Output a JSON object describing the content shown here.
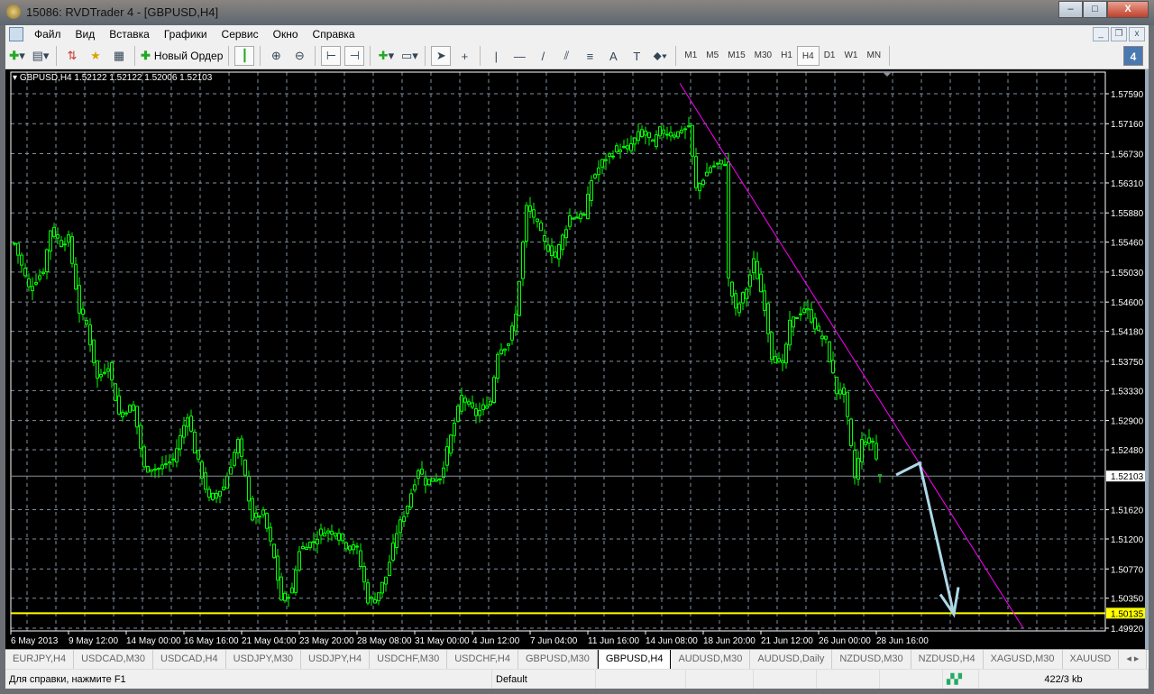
{
  "window": {
    "title": "15086: RVDTrader 4 - [GBPUSD,H4]",
    "min": "‒",
    "max": "□",
    "close": "X"
  },
  "menu": [
    "Файл",
    "Вид",
    "Вставка",
    "Графики",
    "Сервис",
    "Окно",
    "Справка"
  ],
  "toolbar": {
    "new_order": "Новый Ордер",
    "tools": [
      "A",
      "T"
    ],
    "timeframes": [
      "M1",
      "M5",
      "M15",
      "M30",
      "H1",
      "H4",
      "D1",
      "W1",
      "MN"
    ],
    "active_timeframe": "H4",
    "notification_count": "4"
  },
  "chart_header": "GBPUSD,H4  1.52122 1.52122 1.52006 1.52103",
  "chart_data": {
    "type": "candlestick",
    "symbol": "GBPUSD",
    "timeframe": "H4",
    "ohlc_last": {
      "open": 1.52122,
      "high": 1.52122,
      "low": 1.52006,
      "close": 1.52103
    },
    "bars": 241,
    "close_path": [
      [
        0,
        1.5544
      ],
      [
        4,
        1.548
      ],
      [
        8,
        1.5505
      ],
      [
        10,
        1.5564
      ],
      [
        13,
        1.5544
      ],
      [
        15,
        1.5551
      ],
      [
        18,
        1.5447
      ],
      [
        20,
        1.5428
      ],
      [
        23,
        1.535
      ],
      [
        26,
        1.537
      ],
      [
        29,
        1.5299
      ],
      [
        33,
        1.5311
      ],
      [
        36,
        1.5221
      ],
      [
        40,
        1.5221
      ],
      [
        44,
        1.5234
      ],
      [
        48,
        1.5299
      ],
      [
        50,
        1.5247
      ],
      [
        54,
        1.5176
      ],
      [
        58,
        1.5195
      ],
      [
        62,
        1.526
      ],
      [
        64,
        1.5208
      ],
      [
        66,
        1.515
      ],
      [
        69,
        1.5156
      ],
      [
        72,
        1.5092
      ],
      [
        74,
        1.5033
      ],
      [
        77,
        1.5046
      ],
      [
        79,
        1.5105
      ],
      [
        83,
        1.5117
      ],
      [
        85,
        1.513
      ],
      [
        89,
        1.513
      ],
      [
        92,
        1.5111
      ],
      [
        95,
        1.5105
      ],
      [
        98,
        1.5033
      ],
      [
        100,
        1.5033
      ],
      [
        103,
        1.5066
      ],
      [
        106,
        1.513
      ],
      [
        109,
        1.5169
      ],
      [
        112,
        1.5221
      ],
      [
        114,
        1.5202
      ],
      [
        118,
        1.5208
      ],
      [
        122,
        1.5286
      ],
      [
        124,
        1.5324
      ],
      [
        128,
        1.5299
      ],
      [
        132,
        1.5318
      ],
      [
        134,
        1.5389
      ],
      [
        137,
        1.5402
      ],
      [
        139,
        1.5441
      ],
      [
        142,
        1.5596
      ],
      [
        144,
        1.5583
      ],
      [
        147,
        1.5544
      ],
      [
        150,
        1.5525
      ],
      [
        154,
        1.5583
      ],
      [
        158,
        1.5583
      ],
      [
        160,
        1.5635
      ],
      [
        163,
        1.5661
      ],
      [
        167,
        1.568
      ],
      [
        170,
        1.568
      ],
      [
        174,
        1.5706
      ],
      [
        177,
        1.5687
      ],
      [
        179,
        1.5706
      ],
      [
        183,
        1.57
      ],
      [
        187,
        1.5712
      ],
      [
        189,
        1.5622
      ],
      [
        193,
        1.5654
      ],
      [
        197,
        1.5661
      ],
      [
        198,
        1.5492
      ],
      [
        200,
        1.5447
      ],
      [
        203,
        1.548
      ],
      [
        205,
        1.5518
      ],
      [
        208,
        1.5454
      ],
      [
        210,
        1.5383
      ],
      [
        213,
        1.537
      ],
      [
        215,
        1.5428
      ],
      [
        218,
        1.5447
      ],
      [
        220,
        1.5447
      ],
      [
        223,
        1.5415
      ],
      [
        225,
        1.5402
      ],
      [
        228,
        1.5331
      ],
      [
        230,
        1.5331
      ],
      [
        233,
        1.5208
      ],
      [
        235,
        1.526
      ],
      [
        238,
        1.526
      ],
      [
        240,
        1.521
      ]
    ],
    "y_ticks": [
      "1.57590",
      "1.57160",
      "1.56730",
      "1.56310",
      "1.55880",
      "1.55460",
      "1.55030",
      "1.54600",
      "1.54180",
      "1.53750",
      "1.53330",
      "1.52900",
      "1.52480",
      "1.51620",
      "1.51200",
      "1.50770",
      "1.50350",
      "1.49920"
    ],
    "y_tick_values": [
      1.5759,
      1.5716,
      1.5673,
      1.5631,
      1.5588,
      1.5546,
      1.5503,
      1.546,
      1.5418,
      1.5375,
      1.5333,
      1.529,
      1.5248,
      1.5162,
      1.512,
      1.5077,
      1.5035,
      1.4992
    ],
    "x_ticks": [
      "6 May 2013",
      "9 May 12:00",
      "14 May 00:00",
      "16 May 16:00",
      "21 May 04:00",
      "23 May 20:00",
      "28 May 08:00",
      "31 May 00:00",
      "4 Jun 12:00",
      "7 Jun 04:00",
      "11 Jun 16:00",
      "14 Jun 08:00",
      "18 Jun 20:00",
      "21 Jun 12:00",
      "26 Jun 00:00",
      "28 Jun 16:00"
    ],
    "x_tick_bars_step": 16,
    "bid_price": "1.52103",
    "bid_value": 1.52103,
    "support_line": "1.50135",
    "support_value": 1.50135,
    "trendline": [
      [
        184.5,
        1.5774
      ],
      [
        279.75,
        1.4992
      ]
    ],
    "forecast_arrow": [
      [
        244.5,
        1.5212
      ],
      [
        251,
        1.5229
      ],
      [
        260.5,
        1.5012
      ]
    ],
    "colors": {
      "candle": "#00ff00",
      "trendline": "#ff00ff",
      "support": "#ffff00",
      "arrow": "#add8e6",
      "grid": "#8090a0"
    }
  },
  "tabs": [
    "EURJPY,H4",
    "USDCAD,M30",
    "USDCAD,H4",
    "USDJPY,M30",
    "USDJPY,H4",
    "USDCHF,M30",
    "USDCHF,H4",
    "GBPUSD,M30",
    "GBPUSD,H4",
    "AUDUSD,M30",
    "AUDUSD,Daily",
    "NZDUSD,M30",
    "NZDUSD,H4",
    "XAGUSD,M30",
    "XAUUSD"
  ],
  "active_tab": "GBPUSD,H4",
  "status": {
    "help": "Для справки, нажмите F1",
    "profile": "Default",
    "traffic": "422/3 kb"
  }
}
